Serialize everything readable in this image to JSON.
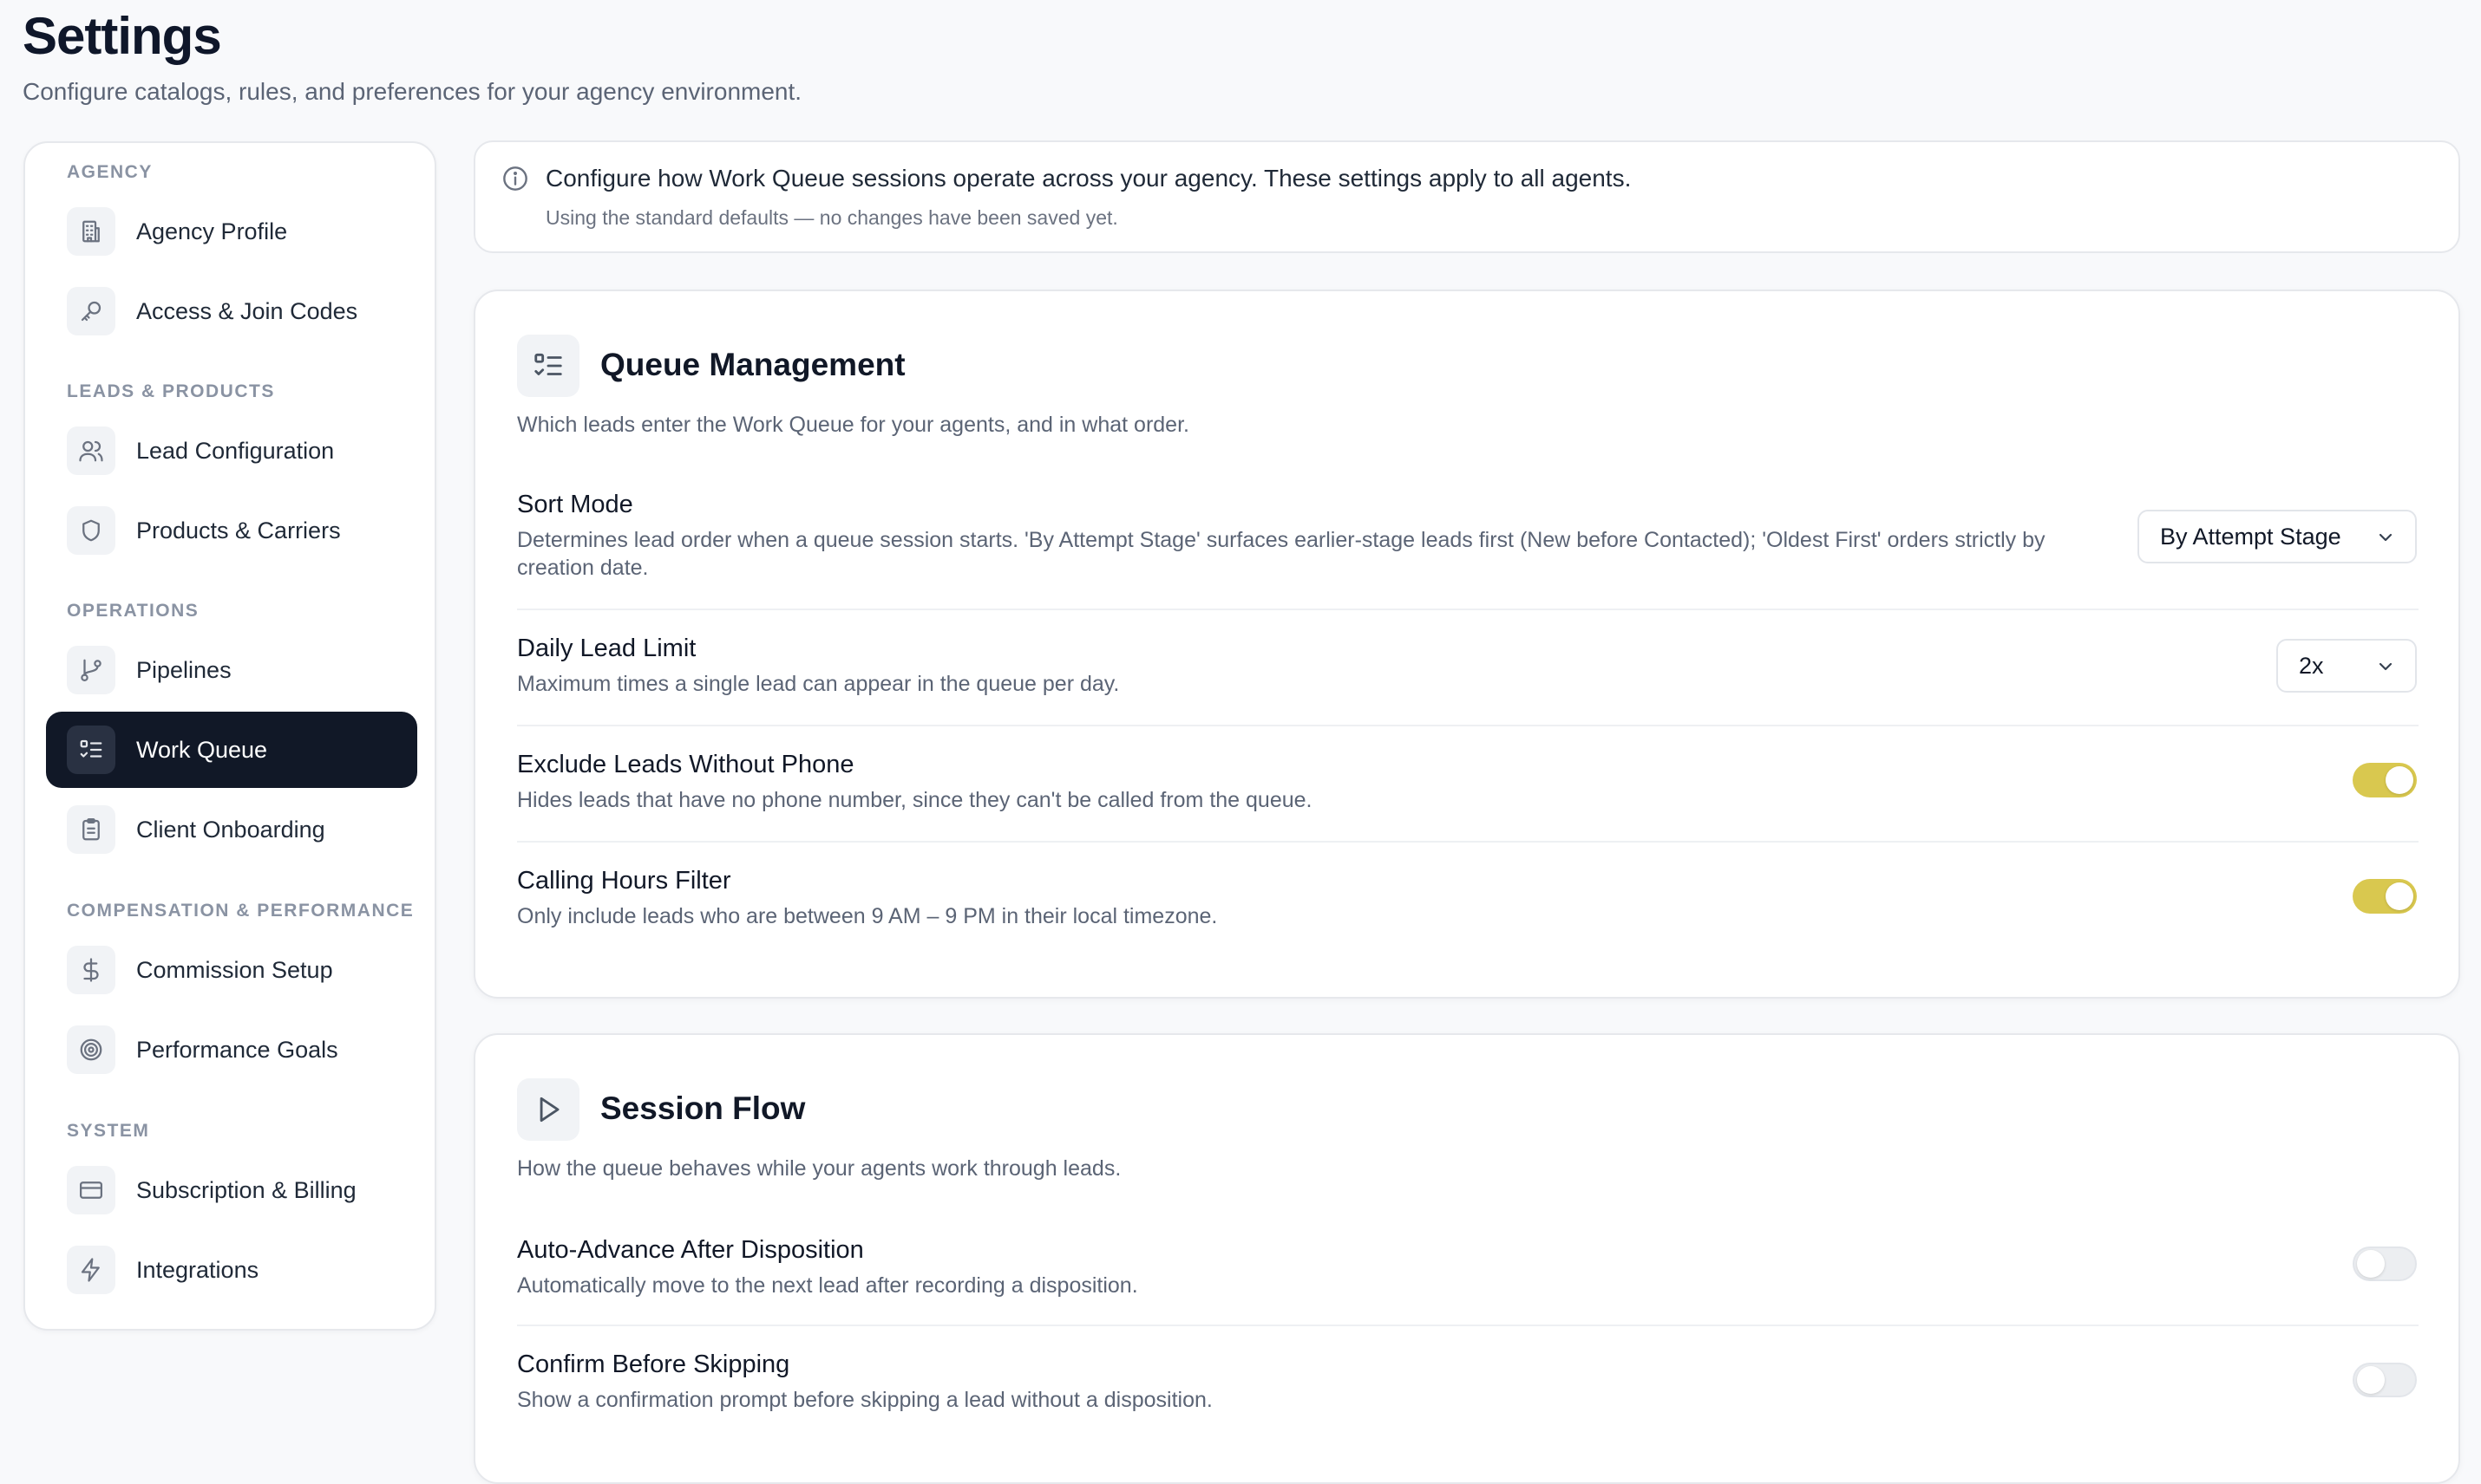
{
  "header": {
    "title": "Settings",
    "subtitle": "Configure catalogs, rules, and preferences for your agency environment."
  },
  "sidebar": {
    "sections": [
      {
        "label": "AGENCY"
      },
      {
        "label": "LEADS & PRODUCTS"
      },
      {
        "label": "OPERATIONS"
      },
      {
        "label": "COMPENSATION & PERFORMANCE"
      },
      {
        "label": "SYSTEM"
      }
    ],
    "items": [
      {
        "label": "Agency Profile",
        "icon": "building-icon"
      },
      {
        "label": "Access & Join Codes",
        "icon": "key-icon"
      },
      {
        "label": "Lead Configuration",
        "icon": "users-icon"
      },
      {
        "label": "Products & Carriers",
        "icon": "shield-icon"
      },
      {
        "label": "Pipelines",
        "icon": "git-branch-icon"
      },
      {
        "label": "Work Queue",
        "icon": "list-checks-icon",
        "active": true
      },
      {
        "label": "Client Onboarding",
        "icon": "clipboard-icon"
      },
      {
        "label": "Commission Setup",
        "icon": "dollar-icon"
      },
      {
        "label": "Performance Goals",
        "icon": "target-icon"
      },
      {
        "label": "Subscription & Billing",
        "icon": "credit-card-icon"
      },
      {
        "label": "Integrations",
        "icon": "zap-icon"
      }
    ]
  },
  "info": {
    "main": "Configure how Work Queue sessions operate across your agency. These settings apply to all agents.",
    "sub": "Using the standard defaults — no changes have been saved yet."
  },
  "queue": {
    "title": "Queue Management",
    "desc": "Which leads enter the Work Queue for your agents, and in what order.",
    "sort_mode": {
      "title": "Sort Mode",
      "desc": "Determines lead order when a queue session starts. 'By Attempt Stage' surfaces earlier-stage leads first (New before Contacted); 'Oldest First' orders strictly by creation date.",
      "value": "By Attempt Stage"
    },
    "daily_limit": {
      "title": "Daily Lead Limit",
      "desc": "Maximum times a single lead can appear in the queue per day.",
      "value": "2x"
    },
    "exclude_phone": {
      "title": "Exclude Leads Without Phone",
      "desc": "Hides leads that have no phone number, since they can't be called from the queue.",
      "enabled": true
    },
    "calling_hours": {
      "title": "Calling Hours Filter",
      "desc": "Only include leads who are between 9 AM – 9 PM in their local timezone.",
      "enabled": true
    }
  },
  "session": {
    "title": "Session Flow",
    "desc": "How the queue behaves while your agents work through leads.",
    "auto_advance": {
      "title": "Auto-Advance After Disposition",
      "desc": "Automatically move to the next lead after recording a disposition.",
      "enabled": false
    },
    "confirm_skip": {
      "title": "Confirm Before Skipping",
      "desc": "Show a confirmation prompt before skipping a lead without a disposition.",
      "enabled": false
    }
  },
  "colors": {
    "accent_toggle": "#d9c84f",
    "active_nav": "#111827"
  }
}
